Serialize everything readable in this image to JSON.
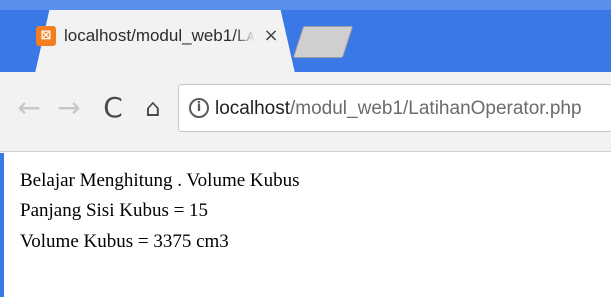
{
  "browser": {
    "tab": {
      "favicon": "xampp-icon",
      "favicon_glyph": "⊠",
      "title": "localhost/modul_web1/Lᴀ",
      "close_glyph": "×"
    },
    "toolbar": {
      "back_glyph": "←",
      "forward_glyph": "→",
      "reload_glyph": "C",
      "home_glyph": "⌂",
      "info_glyph": "i"
    },
    "address": {
      "host": "localhost",
      "path": "/modul_web1/LatihanOperator.php"
    },
    "colors": {
      "accent": "#3b78e7",
      "favicon": "#f47f20"
    }
  },
  "page": {
    "lines": [
      "Belajar Menghitung . Volume Kubus",
      "Panjang Sisi Kubus = 15",
      "Volume Kubus = 3375 cm3"
    ]
  }
}
